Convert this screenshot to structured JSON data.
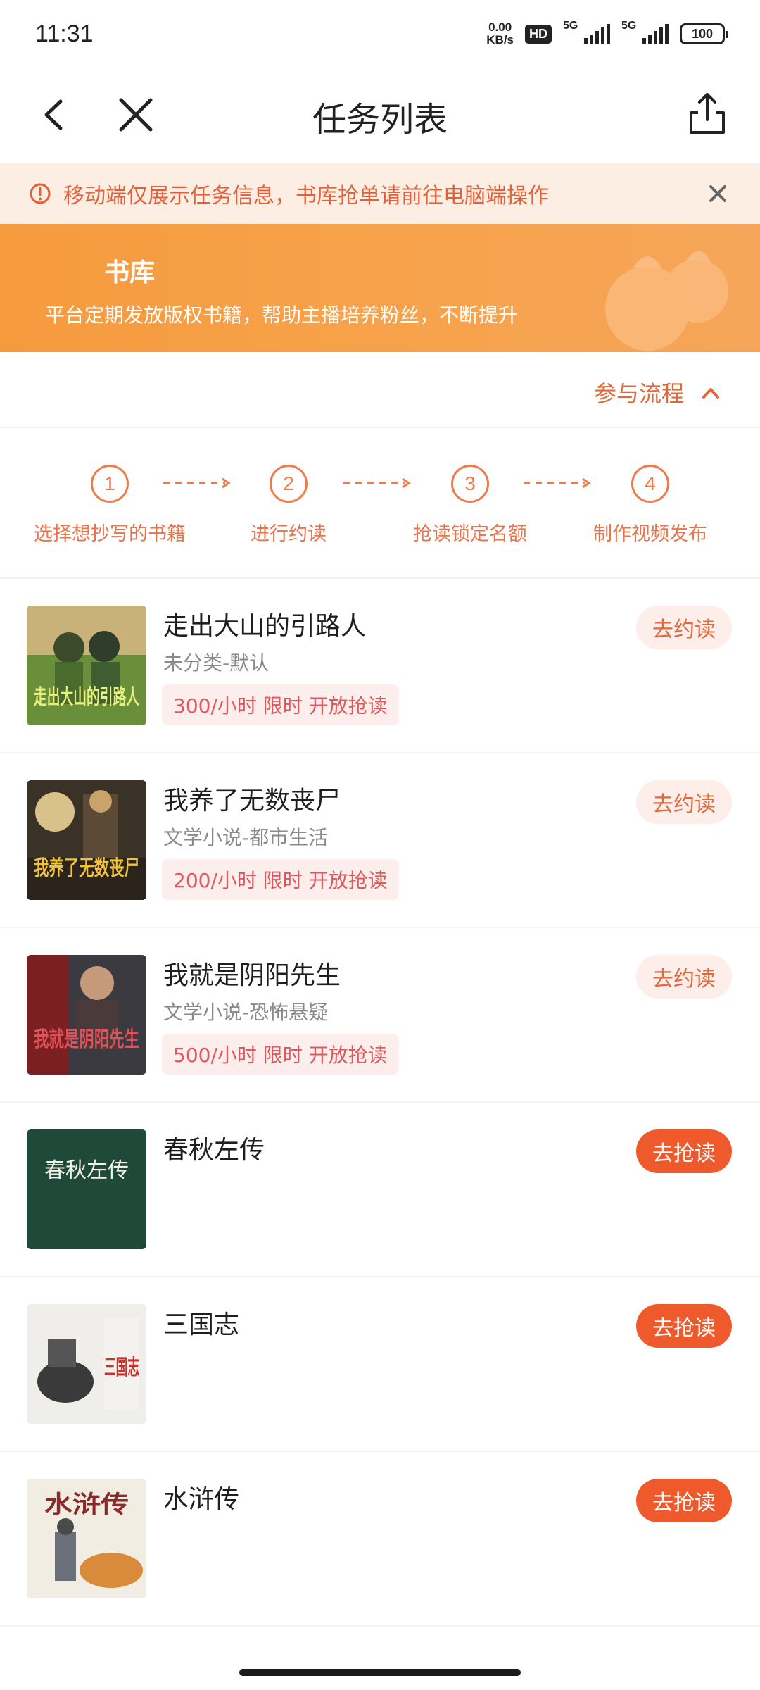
{
  "status_bar": {
    "time": "11:31",
    "net_speed_value": "0.00",
    "net_speed_unit": "KB/s",
    "hd_badge": "HD",
    "network_1": "5G",
    "network_2": "5G",
    "battery": "100"
  },
  "nav": {
    "title": "任务列表"
  },
  "notice": {
    "text": "移动端仅展示任务信息，书库抢单请前往电脑端操作"
  },
  "banner": {
    "title": "书库",
    "subtitle": "平台定期发放版权书籍，帮助主播培养粉丝，不断提升"
  },
  "process": {
    "toggle_label": "参与流程",
    "steps": [
      {
        "num": "1",
        "label": "选择想抄写的书籍"
      },
      {
        "num": "2",
        "label": "进行约读"
      },
      {
        "num": "3",
        "label": "抢读锁定名额"
      },
      {
        "num": "4",
        "label": "制作视频发布"
      }
    ]
  },
  "books": [
    {
      "title": "走出大山的引路人",
      "category": "未分类-默认",
      "tag": "300/小时  限时  开放抢读",
      "action": "去约读",
      "action_style": "light",
      "cover_text": "走出大山的引路人"
    },
    {
      "title": "我养了无数丧尸",
      "category": "文学小说-都市生活",
      "tag": "200/小时  限时  开放抢读",
      "action": "去约读",
      "action_style": "light",
      "cover_text": "我养了无数丧尸"
    },
    {
      "title": "我就是阴阳先生",
      "category": "文学小说-恐怖悬疑",
      "tag": "500/小时  限时  开放抢读",
      "action": "去约读",
      "action_style": "light",
      "cover_text": "我就是阴阳先生"
    },
    {
      "title": "春秋左传",
      "category": "",
      "tag": "",
      "action": "去抢读",
      "action_style": "solid",
      "cover_text": "春秋左传"
    },
    {
      "title": "三国志",
      "category": "",
      "tag": "",
      "action": "去抢读",
      "action_style": "solid",
      "cover_text": "三国志"
    },
    {
      "title": "水浒传",
      "category": "",
      "tag": "",
      "action": "去抢读",
      "action_style": "solid",
      "cover_text": "水浒传"
    }
  ],
  "colors": {
    "accent": "#ef5a2c",
    "banner": "#f7a24a",
    "notice_bg": "#fdeee3",
    "tag_bg": "#fdeeee"
  }
}
